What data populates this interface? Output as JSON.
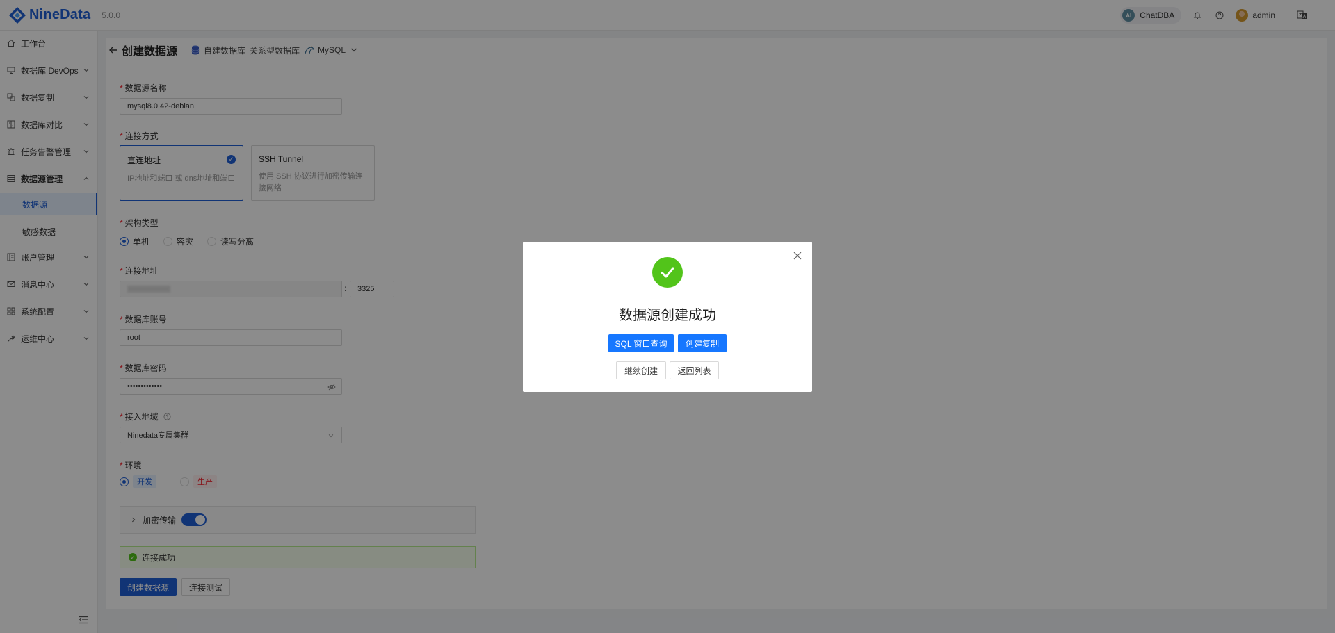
{
  "app": {
    "name": "NineData",
    "version": "5.0.0"
  },
  "topbar": {
    "chatdba_badge": "AI",
    "chatdba_label": "ChatDBA",
    "user_name": "admin"
  },
  "sidebar": {
    "items": [
      {
        "label": "工作台"
      },
      {
        "label": "数据库 DevOps"
      },
      {
        "label": "数据复制"
      },
      {
        "label": "数据库对比"
      },
      {
        "label": "任务告警管理"
      },
      {
        "label": "数据源管理"
      },
      {
        "label": "账户管理"
      },
      {
        "label": "消息中心"
      },
      {
        "label": "系统配置"
      },
      {
        "label": "运维中心"
      }
    ],
    "subitems": [
      {
        "label": "数据源"
      },
      {
        "label": "敏感数据"
      }
    ]
  },
  "page": {
    "title": "创建数据源",
    "crumbs": [
      "自建数据库",
      "关系型数据库",
      "MySQL"
    ]
  },
  "form": {
    "name_label": "数据源名称",
    "name_value": "mysql8.0.42-debian",
    "conn_label": "连接方式",
    "conn_options": [
      {
        "title": "直连地址",
        "desc": "IP地址和端口 或 dns地址和端口"
      },
      {
        "title": "SSH Tunnel",
        "desc": "使用 SSH 协议进行加密传输连接网络"
      }
    ],
    "arch_label": "架构类型",
    "arch_options": [
      "单机",
      "容灾",
      "读写分离"
    ],
    "addr_label": "连接地址",
    "addr_sep": ":",
    "port_value": "3325",
    "account_label": "数据库账号",
    "account_value": "root",
    "password_label": "数据库密码",
    "password_value": "•••••••••••••",
    "region_label": "接入地域",
    "region_value": "Ninedata专属集群",
    "env_label": "环境",
    "env_options": [
      "开发",
      "生产"
    ],
    "encrypt_label": "加密传输",
    "success_msg": "连接成功",
    "create_btn": "创建数据源",
    "test_btn": "连接测试"
  },
  "modal": {
    "title": "数据源创建成功",
    "sql_btn": "SQL 窗口查询",
    "copy_btn": "创建复制",
    "continue_btn": "继续创建",
    "back_btn": "返回列表"
  }
}
